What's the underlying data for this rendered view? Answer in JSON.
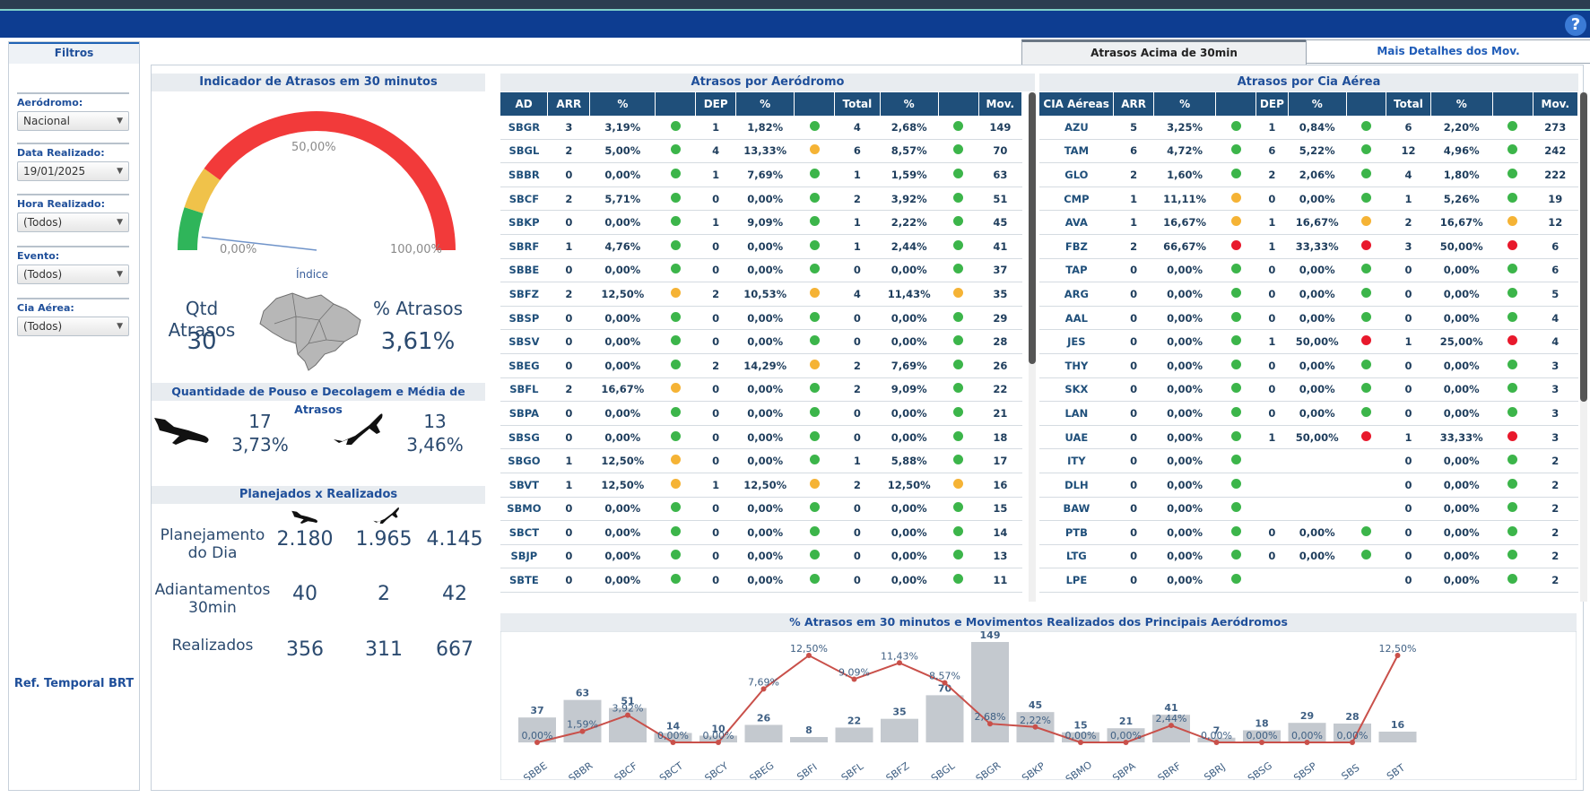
{
  "help_label": "?",
  "filters": {
    "title": "Filtros",
    "groups": [
      {
        "label": "Aeródromo:",
        "value": "Nacional"
      },
      {
        "label": "Data Realizado:",
        "value": "19/01/2025"
      },
      {
        "label": "Hora Realizado:",
        "value": "(Todos)"
      },
      {
        "label": "Evento:",
        "value": "(Todos)"
      },
      {
        "label": "Cia Aérea:",
        "value": "(Todos)"
      }
    ],
    "ref": "Ref. Temporal BRT"
  },
  "tabs": [
    "Atrasos Acima de 30min",
    "Mais Detalhes dos Mov."
  ],
  "gauge": {
    "title": "Indicador de Atrasos em 30 minutos",
    "min_label": "0,00%",
    "mid_label": "50,00%",
    "max_label": "100,00%",
    "caption": "Índice",
    "value_percent": 3.61,
    "colors": {
      "green": "#2fb55a",
      "yellow": "#f0c24a",
      "red": "#f23a3a"
    }
  },
  "summary": {
    "qtd_label": "Qtd Atrasos",
    "qtd_value": "30",
    "pct_label": "% Atrasos",
    "pct_value": "3,61%"
  },
  "pouso": {
    "title": "Quantidade de Pouso e Decolagem e Média de Atrasos",
    "arr_count": "17",
    "arr_pct": "3,73%",
    "dep_count": "13",
    "dep_pct": "3,46%"
  },
  "planejados": {
    "title": "Planejados x Realizados",
    "rows": [
      {
        "label": "Planejamento do Dia",
        "arr": "2.180",
        "dep": "1.965",
        "total": "4.145"
      },
      {
        "label": "Adiantamentos 30min",
        "arr": "40",
        "dep": "2",
        "total": "42"
      },
      {
        "label": "Realizados",
        "arr": "356",
        "dep": "311",
        "total": "667"
      }
    ]
  },
  "aerodromo_table": {
    "title": "Atrasos por Aeródromo",
    "headers": [
      "AD",
      "ARR",
      "%",
      "",
      "DEP",
      "%",
      "",
      "Total",
      "%",
      "",
      "Mov."
    ],
    "rows": [
      [
        "SBGR",
        "3",
        "3,19%",
        "green",
        "1",
        "1,82%",
        "green",
        "4",
        "2,68%",
        "green",
        "149"
      ],
      [
        "SBGL",
        "2",
        "5,00%",
        "green",
        "4",
        "13,33%",
        "yellow",
        "6",
        "8,57%",
        "green",
        "70"
      ],
      [
        "SBBR",
        "0",
        "0,00%",
        "green",
        "1",
        "7,69%",
        "green",
        "1",
        "1,59%",
        "green",
        "63"
      ],
      [
        "SBCF",
        "2",
        "5,71%",
        "green",
        "0",
        "0,00%",
        "green",
        "2",
        "3,92%",
        "green",
        "51"
      ],
      [
        "SBKP",
        "0",
        "0,00%",
        "green",
        "1",
        "9,09%",
        "green",
        "1",
        "2,22%",
        "green",
        "45"
      ],
      [
        "SBRF",
        "1",
        "4,76%",
        "green",
        "0",
        "0,00%",
        "green",
        "1",
        "2,44%",
        "green",
        "41"
      ],
      [
        "SBBE",
        "0",
        "0,00%",
        "green",
        "0",
        "0,00%",
        "green",
        "0",
        "0,00%",
        "green",
        "37"
      ],
      [
        "SBFZ",
        "2",
        "12,50%",
        "yellow",
        "2",
        "10,53%",
        "yellow",
        "4",
        "11,43%",
        "yellow",
        "35"
      ],
      [
        "SBSP",
        "0",
        "0,00%",
        "green",
        "0",
        "0,00%",
        "green",
        "0",
        "0,00%",
        "green",
        "29"
      ],
      [
        "SBSV",
        "0",
        "0,00%",
        "green",
        "0",
        "0,00%",
        "green",
        "0",
        "0,00%",
        "green",
        "28"
      ],
      [
        "SBEG",
        "0",
        "0,00%",
        "green",
        "2",
        "14,29%",
        "yellow",
        "2",
        "7,69%",
        "green",
        "26"
      ],
      [
        "SBFL",
        "2",
        "16,67%",
        "yellow",
        "0",
        "0,00%",
        "green",
        "2",
        "9,09%",
        "green",
        "22"
      ],
      [
        "SBPA",
        "0",
        "0,00%",
        "green",
        "0",
        "0,00%",
        "green",
        "0",
        "0,00%",
        "green",
        "21"
      ],
      [
        "SBSG",
        "0",
        "0,00%",
        "green",
        "0",
        "0,00%",
        "green",
        "0",
        "0,00%",
        "green",
        "18"
      ],
      [
        "SBGO",
        "1",
        "12,50%",
        "yellow",
        "0",
        "0,00%",
        "green",
        "1",
        "5,88%",
        "green",
        "17"
      ],
      [
        "SBVT",
        "1",
        "12,50%",
        "yellow",
        "1",
        "12,50%",
        "yellow",
        "2",
        "12,50%",
        "yellow",
        "16"
      ],
      [
        "SBMO",
        "0",
        "0,00%",
        "green",
        "0",
        "0,00%",
        "green",
        "0",
        "0,00%",
        "green",
        "15"
      ],
      [
        "SBCT",
        "0",
        "0,00%",
        "green",
        "0",
        "0,00%",
        "green",
        "0",
        "0,00%",
        "green",
        "14"
      ],
      [
        "SBJP",
        "0",
        "0,00%",
        "green",
        "0",
        "0,00%",
        "green",
        "0",
        "0,00%",
        "green",
        "13"
      ],
      [
        "SBTE",
        "0",
        "0,00%",
        "green",
        "0",
        "0,00%",
        "green",
        "0",
        "0,00%",
        "green",
        "11"
      ]
    ]
  },
  "cia_table": {
    "title": "Atrasos por Cia Aérea",
    "headers": [
      "CIA Aéreas",
      "ARR",
      "%",
      "",
      "DEP",
      "%",
      "",
      "Total",
      "%",
      "",
      "Mov."
    ],
    "rows": [
      [
        "AZU",
        "5",
        "3,25%",
        "green",
        "1",
        "0,84%",
        "green",
        "6",
        "2,20%",
        "green",
        "273"
      ],
      [
        "TAM",
        "6",
        "4,72%",
        "green",
        "6",
        "5,22%",
        "green",
        "12",
        "4,96%",
        "green",
        "242"
      ],
      [
        "GLO",
        "2",
        "1,60%",
        "green",
        "2",
        "2,06%",
        "green",
        "4",
        "1,80%",
        "green",
        "222"
      ],
      [
        "CMP",
        "1",
        "11,11%",
        "yellow",
        "0",
        "0,00%",
        "green",
        "1",
        "5,26%",
        "green",
        "19"
      ],
      [
        "AVA",
        "1",
        "16,67%",
        "yellow",
        "1",
        "16,67%",
        "yellow",
        "2",
        "16,67%",
        "yellow",
        "12"
      ],
      [
        "FBZ",
        "2",
        "66,67%",
        "red",
        "1",
        "33,33%",
        "red",
        "3",
        "50,00%",
        "red",
        "6"
      ],
      [
        "TAP",
        "0",
        "0,00%",
        "green",
        "0",
        "0,00%",
        "green",
        "0",
        "0,00%",
        "green",
        "6"
      ],
      [
        "ARG",
        "0",
        "0,00%",
        "green",
        "0",
        "0,00%",
        "green",
        "0",
        "0,00%",
        "green",
        "5"
      ],
      [
        "AAL",
        "0",
        "0,00%",
        "green",
        "0",
        "0,00%",
        "green",
        "0",
        "0,00%",
        "green",
        "4"
      ],
      [
        "JES",
        "0",
        "0,00%",
        "green",
        "1",
        "50,00%",
        "red",
        "1",
        "25,00%",
        "red",
        "4"
      ],
      [
        "THY",
        "0",
        "0,00%",
        "green",
        "0",
        "0,00%",
        "green",
        "0",
        "0,00%",
        "green",
        "3"
      ],
      [
        "SKX",
        "0",
        "0,00%",
        "green",
        "0",
        "0,00%",
        "green",
        "0",
        "0,00%",
        "green",
        "3"
      ],
      [
        "LAN",
        "0",
        "0,00%",
        "green",
        "0",
        "0,00%",
        "green",
        "0",
        "0,00%",
        "green",
        "3"
      ],
      [
        "UAE",
        "0",
        "0,00%",
        "green",
        "1",
        "50,00%",
        "red",
        "1",
        "33,33%",
        "red",
        "3"
      ],
      [
        "ITY",
        "0",
        "0,00%",
        "green",
        "",
        "",
        "",
        "0",
        "0,00%",
        "green",
        "2"
      ],
      [
        "DLH",
        "0",
        "0,00%",
        "green",
        "",
        "",
        "",
        "0",
        "0,00%",
        "green",
        "2"
      ],
      [
        "BAW",
        "0",
        "0,00%",
        "green",
        "",
        "",
        "",
        "0",
        "0,00%",
        "green",
        "2"
      ],
      [
        "PTB",
        "0",
        "0,00%",
        "green",
        "0",
        "0,00%",
        "green",
        "0",
        "0,00%",
        "green",
        "2"
      ],
      [
        "LTG",
        "0",
        "0,00%",
        "green",
        "0",
        "0,00%",
        "green",
        "0",
        "0,00%",
        "green",
        "2"
      ],
      [
        "LPE",
        "0",
        "0,00%",
        "green",
        "",
        "",
        "",
        "0",
        "0,00%",
        "green",
        "2"
      ]
    ]
  },
  "chart_data": {
    "type": "bar",
    "title": "% Atrasos em 30 minutos e Movimentos Realizados dos Principais Aeródromos",
    "categories": [
      "SBBE",
      "SBBR",
      "SBCF",
      "SBCT",
      "SBCY",
      "SBEG",
      "SBFI",
      "SBFL",
      "SBFZ",
      "SBGL",
      "SBGR",
      "SBKP",
      "SBMO",
      "SBPA",
      "SBRF",
      "SBRJ",
      "SBSG",
      "SBSP",
      "SBS",
      "SBT"
    ],
    "series": [
      {
        "values": [
          37,
          63,
          51,
          14,
          10,
          26,
          8,
          22,
          35,
          70,
          149,
          45,
          15,
          21,
          41,
          7,
          18,
          29,
          28,
          16
        ],
        "labels": [
          "37",
          "63",
          "51",
          "14",
          "10",
          "26",
          "8",
          "22",
          "35",
          "70",
          "149",
          "45",
          "15",
          "21",
          "41",
          "7",
          "18",
          "29",
          "28",
          "16"
        ]
      },
      {
        "values": [
          0,
          1.59,
          3.92,
          0,
          0,
          7.69,
          12.5,
          9.09,
          11.43,
          8.57,
          2.68,
          2.22,
          0,
          0,
          2.44,
          0,
          0,
          0,
          0,
          12.5
        ],
        "labels": [
          "0,00%",
          "1,59%",
          "3,92%",
          "0,00%",
          "0,00%",
          "7,69%",
          "12,50%",
          "9,09%",
          "11,43%",
          "8,57%",
          "2,68%",
          "2,22%",
          "0,00%",
          "0,00%",
          "2,44%",
          "0,00%",
          "0,00%",
          "0,00%",
          "0,00%",
          "12,50%"
        ]
      }
    ],
    "bar_color": "#c4c9cf",
    "line_color": "#c9504a"
  }
}
